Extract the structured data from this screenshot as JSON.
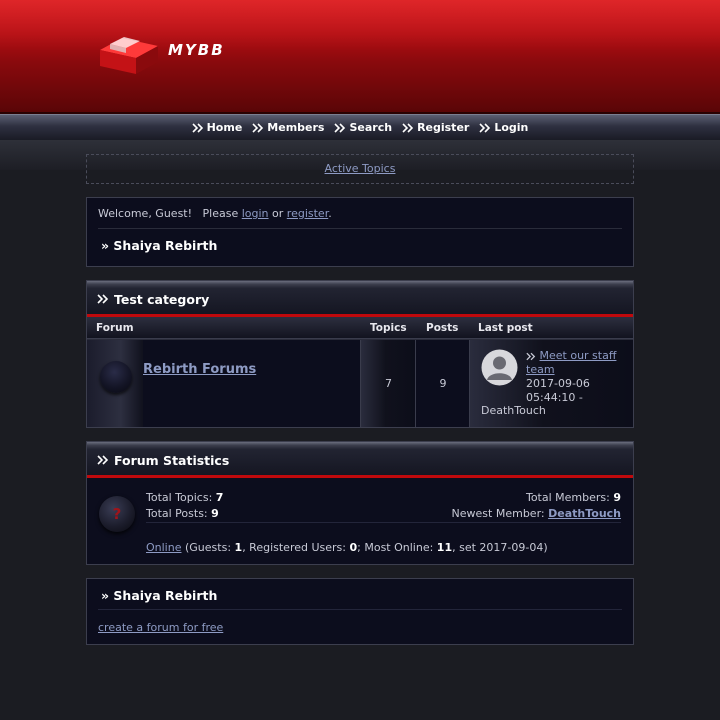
{
  "header": {
    "logo_text": "MYBB"
  },
  "nav": {
    "items": [
      {
        "label": "Home"
      },
      {
        "label": "Members"
      },
      {
        "label": "Search"
      },
      {
        "label": "Register"
      },
      {
        "label": "Login"
      }
    ]
  },
  "active_topics": {
    "label": "Active Topics"
  },
  "welcome": {
    "text": "Welcome, Guest!",
    "please": "Please",
    "login": "login",
    "or": "or",
    "register": "register",
    "period": ".",
    "breadcrumb": "» Shaiya Rebirth"
  },
  "category": {
    "title": "Test category",
    "columns": {
      "forum": "Forum",
      "topics": "Topics",
      "posts": "Posts",
      "last_post": "Last post"
    },
    "forums": [
      {
        "name": "Rebirth Forums",
        "topics": "7",
        "posts": "9",
        "last_post_title": "Meet our staff team",
        "last_post_date": "2017-09-06 05:44:10 -",
        "last_post_user": "DeathTouch"
      }
    ]
  },
  "stats": {
    "title": "Forum Statistics",
    "total_topics_label": "Total Topics:",
    "total_topics": "7",
    "total_posts_label": "Total Posts:",
    "total_posts": "9",
    "total_members_label": "Total Members:",
    "total_members": "9",
    "newest_member_label": "Newest Member:",
    "newest_member": "DeathTouch",
    "online_link": "Online",
    "guests_label": "(Guests:",
    "guests": "1",
    "registered_label": ", Registered Users:",
    "registered": "0",
    "most_online_label": "; Most Online:",
    "most_online": "11",
    "most_online_suffix": ", set 2017-09-04)",
    "icon_glyph": "?"
  },
  "footer": {
    "breadcrumb": "» Shaiya Rebirth",
    "link": "create a forum for free"
  }
}
